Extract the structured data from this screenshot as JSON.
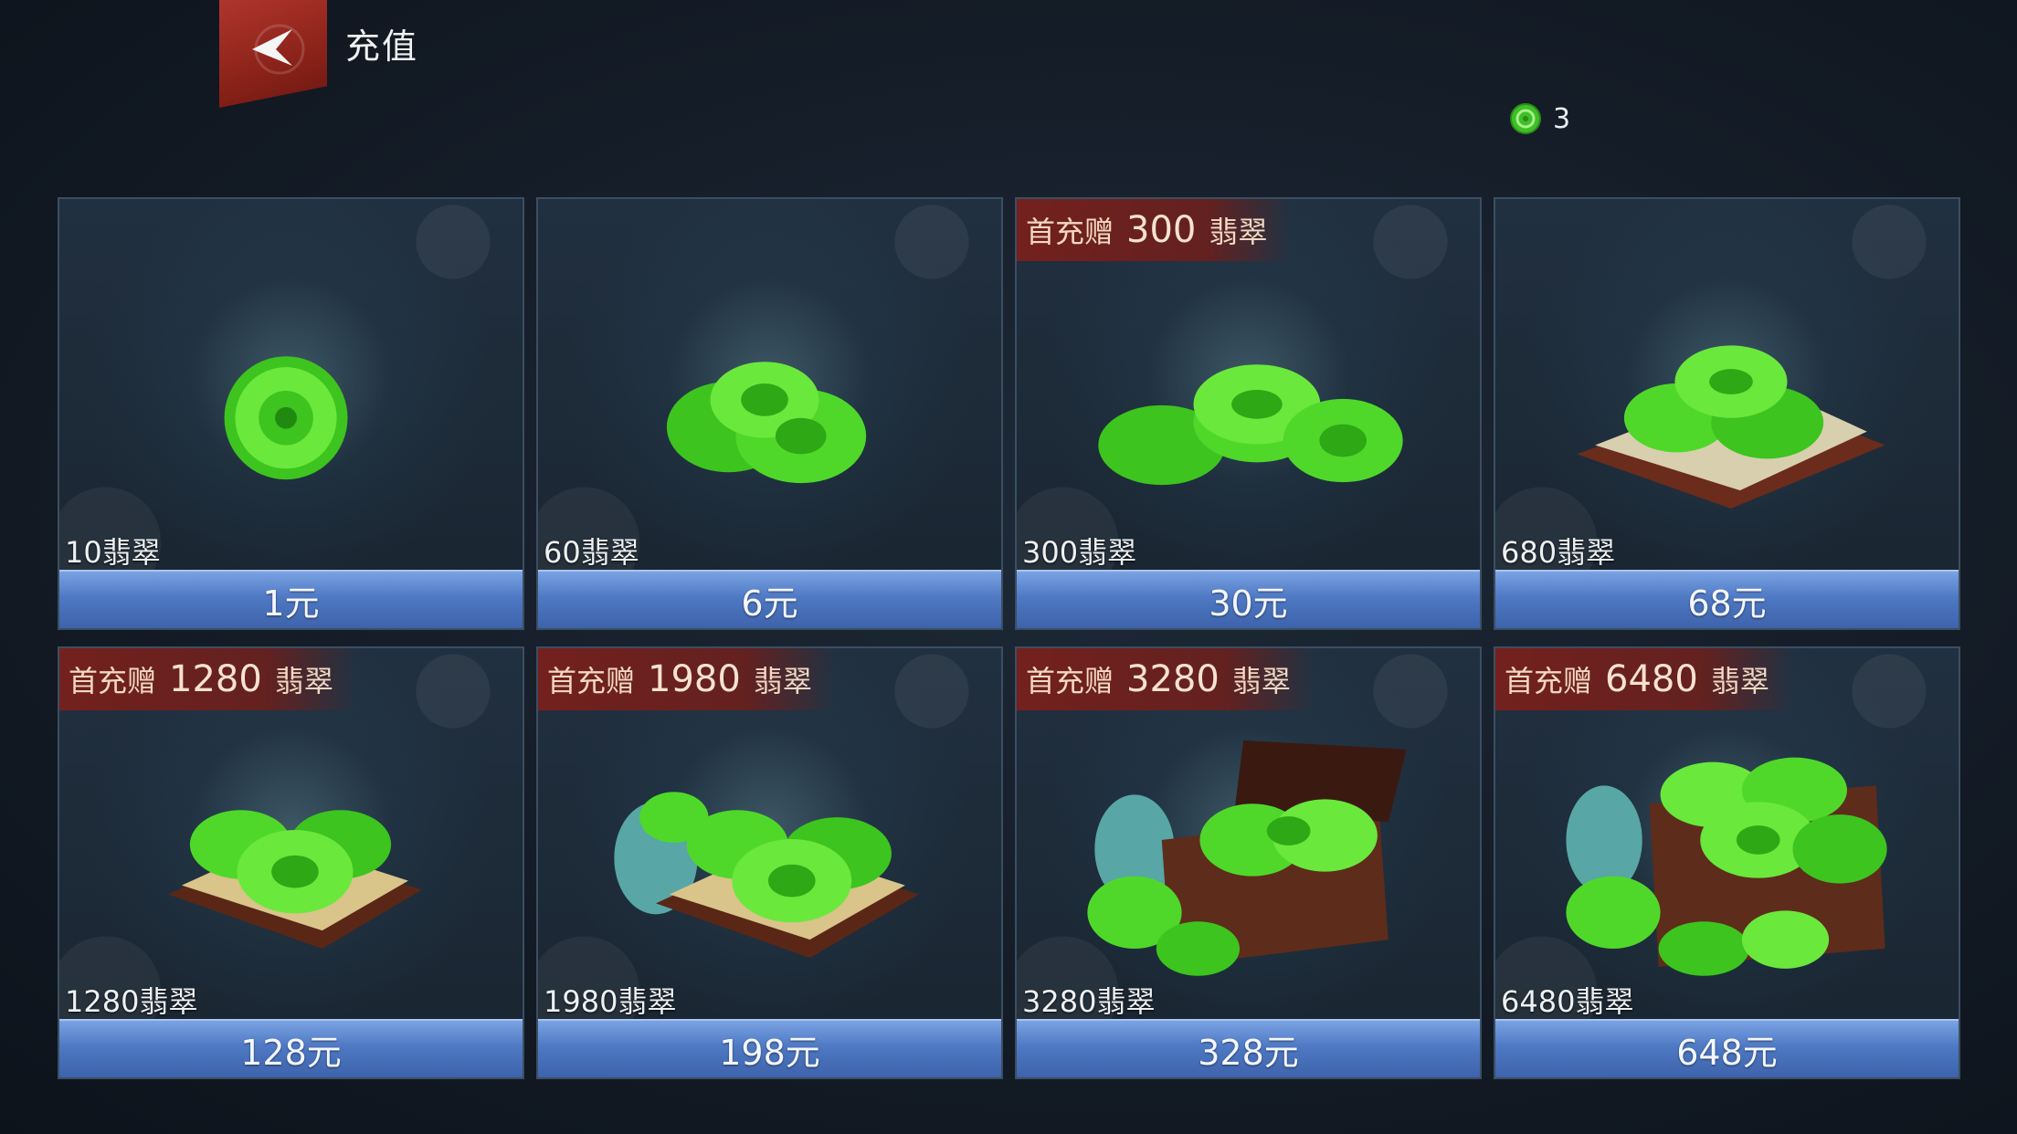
{
  "header": {
    "title": "充值",
    "back_icon": "back-arrow-icon"
  },
  "currency": {
    "icon": "jade-coin-icon",
    "amount": "3"
  },
  "colors": {
    "jade": "#4cd427",
    "bonus_bg": "#7a201c",
    "price_btn": "#4f79c4"
  },
  "packages": [
    {
      "bonus_prefix": "",
      "bonus_amount": "",
      "bonus_suffix": "",
      "quantity": "10翡翠",
      "price": "1元",
      "art": "single-jade-coin"
    },
    {
      "bonus_prefix": "",
      "bonus_amount": "",
      "bonus_suffix": "",
      "quantity": "60翡翠",
      "price": "6元",
      "art": "jade-coin-pile-small"
    },
    {
      "bonus_prefix": "首充赠",
      "bonus_amount": "300",
      "bonus_suffix": "翡翠",
      "quantity": "300翡翠",
      "price": "30元",
      "art": "jade-coin-stacks"
    },
    {
      "bonus_prefix": "",
      "bonus_amount": "",
      "bonus_suffix": "",
      "quantity": "680翡翠",
      "price": "68元",
      "art": "jade-coins-on-cloth-tray"
    },
    {
      "bonus_prefix": "首充赠",
      "bonus_amount": "1280",
      "bonus_suffix": "翡翠",
      "quantity": "1280翡翠",
      "price": "128元",
      "art": "jade-coins-on-wood-tray"
    },
    {
      "bonus_prefix": "首充赠",
      "bonus_amount": "1980",
      "bonus_suffix": "翡翠",
      "quantity": "1980翡翠",
      "price": "198元",
      "art": "jade-coins-table-and-bag"
    },
    {
      "bonus_prefix": "首充赠",
      "bonus_amount": "3280",
      "bonus_suffix": "翡翠",
      "quantity": "3280翡翠",
      "price": "328元",
      "art": "jade-coins-chest"
    },
    {
      "bonus_prefix": "首充赠",
      "bonus_amount": "6480",
      "bonus_suffix": "翡翠",
      "quantity": "6480翡翠",
      "price": "648元",
      "art": "jade-coins-large-chest"
    }
  ]
}
